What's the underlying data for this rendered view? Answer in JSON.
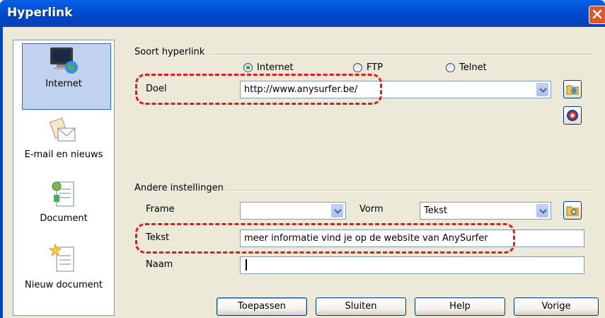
{
  "window": {
    "title": "Hyperlink"
  },
  "sidebar": {
    "items": [
      {
        "label": "Internet",
        "icon": "globe-monitor-icon",
        "selected": true
      },
      {
        "label": "E-mail en nieuws",
        "icon": "envelope-icon",
        "selected": false
      },
      {
        "label": "Document",
        "icon": "document-icon",
        "selected": false
      },
      {
        "label": "Nieuw document",
        "icon": "new-document-icon",
        "selected": false
      }
    ]
  },
  "hyperlink_type": {
    "title": "Soort hyperlink",
    "options": [
      {
        "label": "Internet",
        "selected": true
      },
      {
        "label": "FTP",
        "selected": false
      },
      {
        "label": "Telnet",
        "selected": false
      }
    ],
    "target_label": "Doel",
    "target_value": "http://www.anysurfer.be/"
  },
  "other_settings": {
    "title": "Andere instellingen",
    "frame_label": "Frame",
    "frame_value": "",
    "form_label": "Vorm",
    "form_value": "Tekst",
    "text_label": "Tekst",
    "text_value": "meer informatie vind je op de website van AnySurfer",
    "name_label": "Naam",
    "name_value": ""
  },
  "buttons": {
    "apply": "Toepassen",
    "close": "Sluiten",
    "help": "Help",
    "back": "Vorige"
  },
  "colors": {
    "titlebar": "#0054e3",
    "dialog_bg": "#ece9d8",
    "highlight": "#e21b1b",
    "selected_item": "#c1d2ee"
  }
}
